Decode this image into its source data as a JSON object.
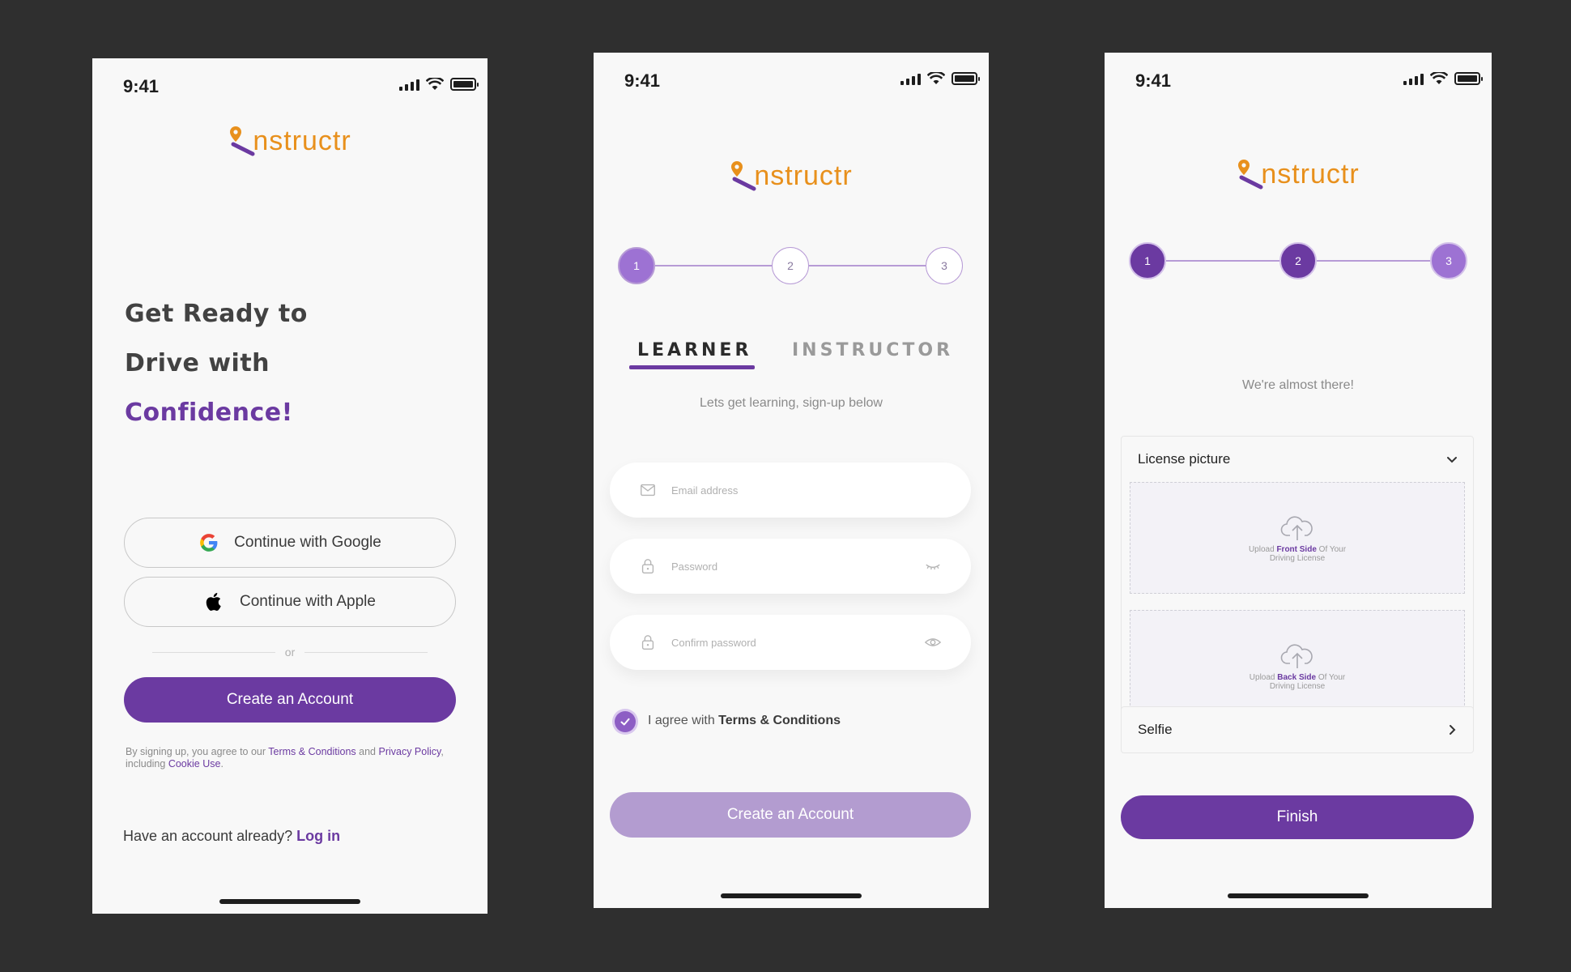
{
  "status_time": "9:41",
  "brand": {
    "logo_text": "nstructr",
    "color": "#e8901c",
    "accent": "#6b3aa1"
  },
  "screen1": {
    "headline": [
      "Get Ready to",
      "Drive with",
      "Confidence!"
    ],
    "google_label": "Continue with Google",
    "apple_label": "Continue with Apple",
    "or_label": "or",
    "create_label": "Create an Account",
    "legal": {
      "prefix": "By signing up, you agree to our",
      "terms": "Terms & Conditions",
      "and": "and",
      "privacy": "Privacy Policy",
      "including": ", including",
      "cookie": "Cookie Use",
      "end": "."
    },
    "login_prompt": "Have an account already?",
    "login_link": "Log in"
  },
  "screen2": {
    "steps": [
      "1",
      "2",
      "3"
    ],
    "tabs": [
      "LEARNER",
      "INSTRUCTOR"
    ],
    "subtitle": "Lets get learning, sign-up below",
    "email_placeholder": "Email address",
    "password_placeholder": "Password",
    "confirm_placeholder": "Confirm password",
    "agree_prefix": "I agree with",
    "agree_terms": "Terms & Conditions",
    "create_label": "Create an Account"
  },
  "screen3": {
    "steps": [
      "1",
      "2",
      "3"
    ],
    "subtitle": "We're almost there!",
    "license_label": "License picture",
    "upload_front": {
      "prefix": "Upload",
      "side": "Front Side",
      "suffix": "Of Your Driving License"
    },
    "upload_back": {
      "prefix": "Upload",
      "side": "Back Side",
      "suffix": "Of Your Driving License"
    },
    "selfie_label": "Selfie",
    "finish_label": "Finish"
  }
}
